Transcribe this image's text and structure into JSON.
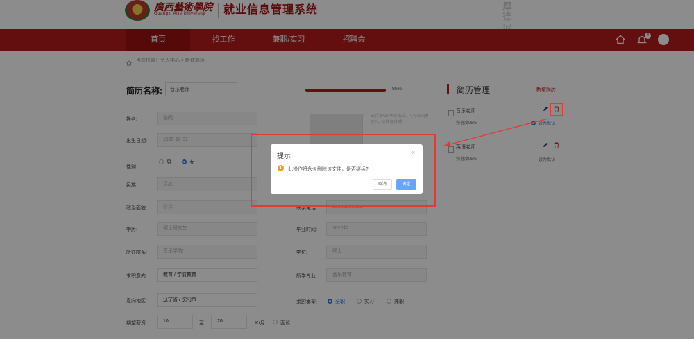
{
  "header": {
    "school_cn": "廣西藝術學院",
    "school_en": "Guangxi Arts University",
    "system_title": "就业信息管理系统",
    "calligraphy": "厚德 诚爱"
  },
  "nav": {
    "items": [
      "首页",
      "找工作",
      "兼职/实习",
      "招聘会"
    ],
    "bell_count": "0"
  },
  "breadcrumb": "当前位置：个人中心 > 新建简历",
  "form": {
    "title_label": "简历名称:",
    "resume_name": "音乐老师",
    "progress_text": "95%",
    "progress": 0.95,
    "photo_hint": "支持JPG/PNG格式，小于3M建议2寸标准证件照",
    "fields": {
      "name_label": "姓名:",
      "name_value": "张同",
      "birth_label": "出生日期:",
      "birth_value": "1995-10-01",
      "gender_label": "性别:",
      "gender_male": "男",
      "gender_female": "女",
      "ethnic_label": "民族:",
      "ethnic_value": "汉族",
      "politics_label": "政治面貌:",
      "politics_value": "群众",
      "edu_label": "学历:",
      "edu_value": "硕士研究生",
      "college_label": "所在院系:",
      "college_value": "音乐学院",
      "contact_label": "联系电话:",
      "contact_value": "13988888888",
      "gradtime_label": "毕业时间:",
      "gradtime_value": "2020年",
      "degree_label": "学位:",
      "degree_value": "硕士",
      "major_label": "所学专业:",
      "major_value": "音乐教育",
      "intent_label": "求职意向:",
      "intent_value": "教育 / 学前教育",
      "region_label": "意向地区:",
      "region_value": "辽宁省 / 沈阳市",
      "jobtype_label": "求职类型:",
      "jobtype_opts": [
        "全职",
        "实习",
        "兼职"
      ],
      "salary_label": "期望薪资:",
      "salary_min": "10",
      "salary_to": "至",
      "salary_max": "20",
      "salary_unit": "K/月",
      "salary_negotiable": "面议"
    }
  },
  "panel": {
    "title": "简历管理",
    "new_link": "新增简历",
    "items": [
      {
        "name": "音乐老师",
        "pct": "完善度95%",
        "default": "设为默认"
      },
      {
        "name": "英语老师",
        "pct": "完善度95%",
        "default": "设为默认"
      }
    ]
  },
  "dialog": {
    "title": "提示",
    "close": "×",
    "message": "此操作将永久删除该文件，是否继续?",
    "cancel": "取消",
    "ok": "确定"
  },
  "colors": {
    "brand": "#b71c1c",
    "primary": "#66a6ff",
    "warning": "#f0a020",
    "highlight": "#e53935"
  }
}
